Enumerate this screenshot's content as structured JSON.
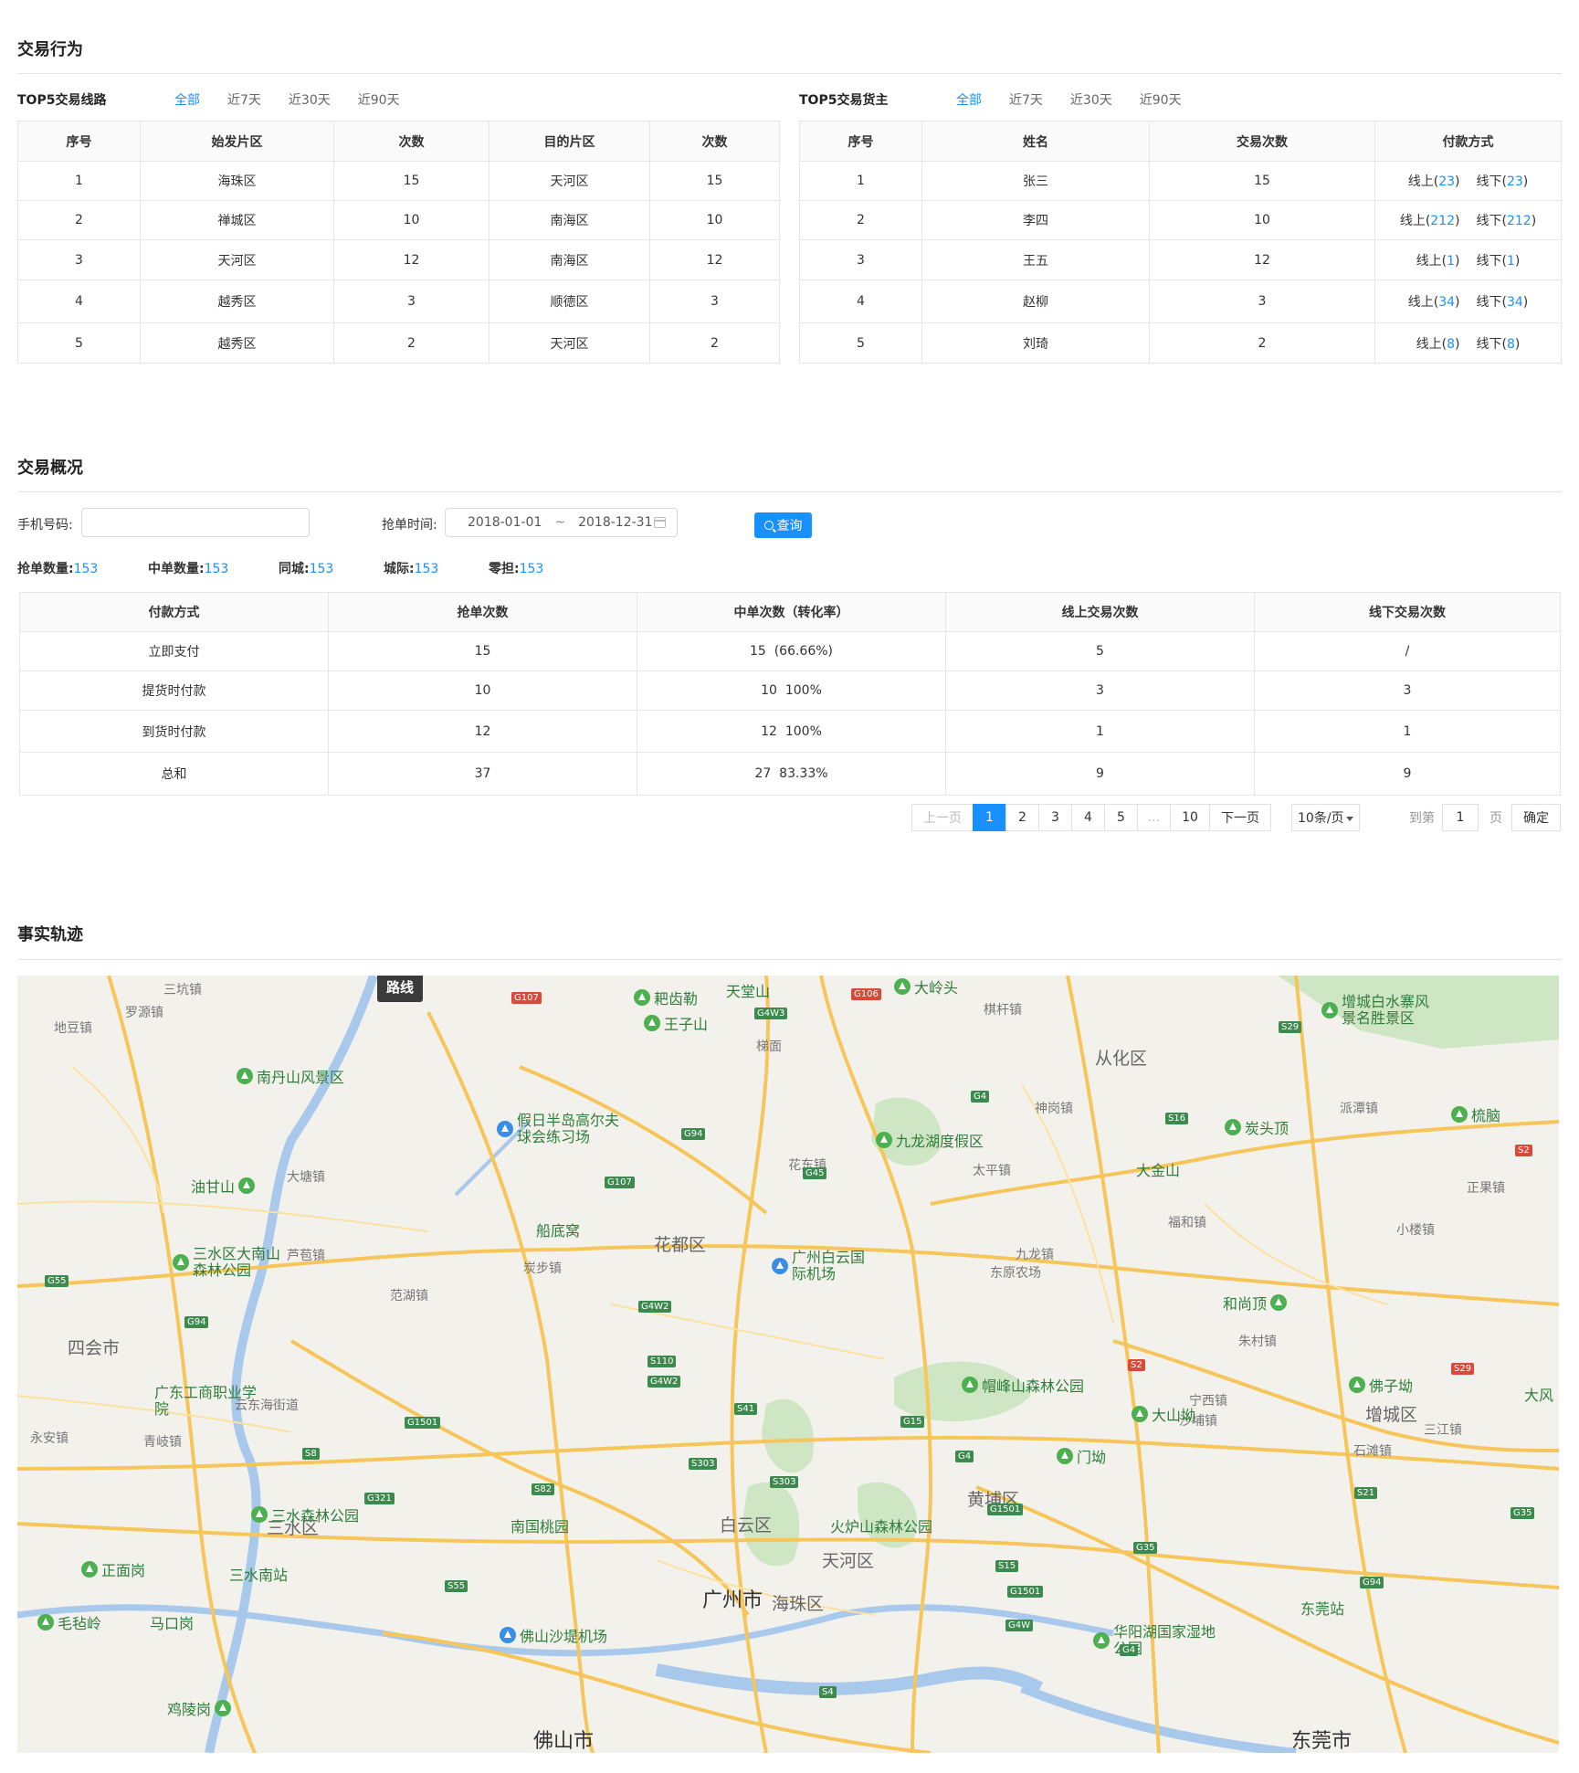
{
  "section1": {
    "title": "交易行为"
  },
  "routes": {
    "title": "TOP5交易线路",
    "filters": [
      "全部",
      "近7天",
      "近30天",
      "近90天"
    ],
    "headers": [
      "序号",
      "始发片区",
      "次数",
      "目的片区",
      "次数"
    ],
    "rows": [
      [
        "1",
        "海珠区",
        "15",
        "天河区",
        "15"
      ],
      [
        "2",
        "禅城区",
        "10",
        "南海区",
        "10"
      ],
      [
        "3",
        "天河区",
        "12",
        "南海区",
        "12"
      ],
      [
        "4",
        "越秀区",
        "3",
        "顺德区",
        "3"
      ],
      [
        "5",
        "越秀区",
        "2",
        "天河区",
        "2"
      ]
    ]
  },
  "shippers": {
    "title": "TOP5交易货主",
    "filters": [
      "全部",
      "近7天",
      "近30天",
      "近90天"
    ],
    "headers": [
      "序号",
      "姓名",
      "交易次数",
      "付款方式"
    ],
    "online_label": "线上",
    "offline_label": "线下",
    "rows": [
      {
        "no": "1",
        "name": "张三",
        "count": "15",
        "online": "23",
        "offline": "23"
      },
      {
        "no": "2",
        "name": "李四",
        "count": "10",
        "online": "212",
        "offline": "212"
      },
      {
        "no": "3",
        "name": "王五",
        "count": "12",
        "online": "1",
        "offline": "1"
      },
      {
        "no": "4",
        "name": "赵柳",
        "count": "3",
        "online": "34",
        "offline": "34"
      },
      {
        "no": "5",
        "name": "刘琦",
        "count": "2",
        "online": "8",
        "offline": "8"
      }
    ]
  },
  "section2": {
    "title": "交易概况"
  },
  "form": {
    "phone_label": "手机号码:",
    "phone_value": "",
    "time_label": "抢单时间:",
    "date_start": "2018-01-01",
    "date_sep": "~",
    "date_end": "2018-12-31",
    "query_label": "查询"
  },
  "stats": [
    {
      "label": "抢单数量:",
      "value": "153"
    },
    {
      "label": "中单数量:",
      "value": "153"
    },
    {
      "label": "同城:",
      "value": "153"
    },
    {
      "label": "城际:",
      "value": "153"
    },
    {
      "label": "零担:",
      "value": "153"
    }
  ],
  "overview": {
    "headers": [
      "付款方式",
      "抢单次数",
      "中单次数（转化率）",
      "线上交易次数",
      "线下交易次数"
    ],
    "rows": [
      {
        "method": "立即支付",
        "grab": "15",
        "win": "15",
        "rate": "(66.66%)",
        "online": "5",
        "offline": "/"
      },
      {
        "method": "提货时付款",
        "grab": "10",
        "win": "10",
        "rate": "100%",
        "online": "3",
        "offline": "3"
      },
      {
        "method": "到货时付款",
        "grab": "12",
        "win": "12",
        "rate": "100%",
        "online": "1",
        "offline": "1"
      },
      {
        "method": "总和",
        "grab": "37",
        "win": "27",
        "rate": "83.33%",
        "online": "9",
        "offline": "9"
      }
    ]
  },
  "pager": {
    "prev": "上一页",
    "pages": [
      "1",
      "2",
      "3",
      "4",
      "5",
      "...",
      "10"
    ],
    "current": "1",
    "next": "下一页",
    "page_size": "10条/页",
    "goto_label": "到第",
    "goto_value": "1",
    "page_unit": "页",
    "ok": "确定"
  },
  "section3": {
    "title": "事实轨迹"
  },
  "map": {
    "route_button": "路线",
    "pois": [
      {
        "label": "耙齿勒"
      },
      {
        "label": "天堂山"
      },
      {
        "label": "王子山"
      },
      {
        "label": "大岭头"
      },
      {
        "label": "增城白水寨风景名胜景区"
      },
      {
        "label": "南丹山风景区"
      },
      {
        "label": "假日半岛高尔夫球会练习场"
      },
      {
        "label": "九龙湖度假区"
      },
      {
        "label": "炭头顶"
      },
      {
        "label": "梳脑"
      },
      {
        "label": "大金山"
      },
      {
        "label": "油甘山"
      },
      {
        "label": "船底窝"
      },
      {
        "label": "广州白云国际机场"
      },
      {
        "label": "三水区大南山森林公园"
      },
      {
        "label": "和尚顶"
      },
      {
        "label": "广东工商职业学院"
      },
      {
        "label": "帽峰山森林公园"
      },
      {
        "label": "大山坳"
      },
      {
        "label": "佛子坳"
      },
      {
        "label": "门坳"
      },
      {
        "label": "三水森林公园"
      },
      {
        "label": "南国桃园"
      },
      {
        "label": "火炉山森林公园"
      },
      {
        "label": "正面岗"
      },
      {
        "label": "三水南站"
      },
      {
        "label": "马口岗"
      },
      {
        "label": "毛毡岭"
      },
      {
        "label": "佛山沙堤机场"
      },
      {
        "label": "华阳湖国家湿地公园"
      },
      {
        "label": "东莞站"
      },
      {
        "label": "鸡陵岗"
      },
      {
        "label": "大风"
      }
    ],
    "towns": [
      "三坑镇",
      "罗源镇",
      "地豆镇",
      "梯面",
      "棋杆镇",
      "神岗镇",
      "派潭镇",
      "大塘镇",
      "花东镇",
      "太平镇",
      "正果镇",
      "芦苞镇",
      "炭步镇",
      "福和镇",
      "小楼镇",
      "九龙镇",
      "东原农场",
      "范湖镇",
      "朱村镇",
      "云东海街道",
      "宁西镇",
      "沙埔镇",
      "三江镇",
      "青岐镇",
      "永安镇",
      "石滩镇"
    ],
    "districts": [
      "从化区",
      "花都区",
      "四会市",
      "三水区",
      "白云区",
      "天河区",
      "黄埔区",
      "海珠区",
      "增城区"
    ],
    "cities": [
      "广州市",
      "佛山市",
      "东莞市"
    ],
    "roads": [
      "G107",
      "G106",
      "G4W3",
      "S29",
      "G4",
      "S16",
      "G94",
      "G45",
      "G107",
      "S2",
      "G55",
      "G94",
      "G4W2",
      "S110",
      "G4W2",
      "S41",
      "G15",
      "G4",
      "S2",
      "S29",
      "G1501",
      "S8",
      "S303",
      "S303",
      "G321",
      "S82",
      "G1501",
      "S21",
      "G35",
      "G35",
      "S15",
      "G1501",
      "S55",
      "G4W",
      "G94",
      "G4",
      "S4"
    ]
  }
}
